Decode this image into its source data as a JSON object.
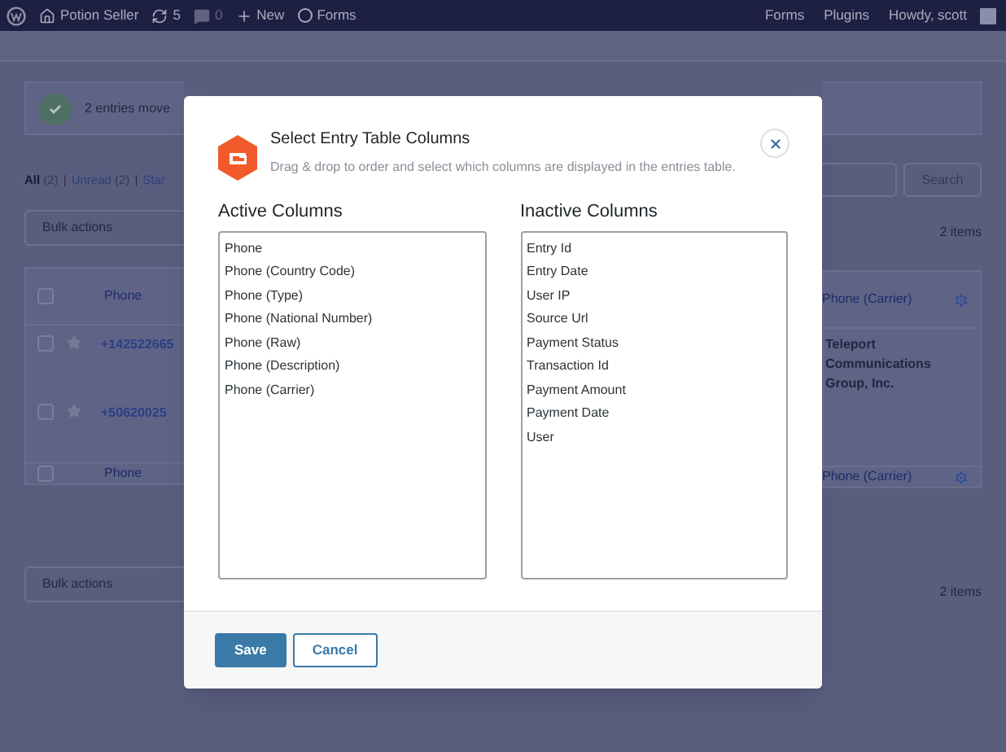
{
  "admin_bar": {
    "site": "Potion Seller",
    "updates": "5",
    "comments": "0",
    "new_label": "New",
    "forms_label": "Forms",
    "right_links": [
      "Forms",
      "Plugins"
    ],
    "greeting": "Howdy, scott"
  },
  "background": {
    "notice": "2 entries move",
    "filters": [
      {
        "label": "All",
        "count": "(2)",
        "selected": true
      },
      {
        "separator": "|",
        "label": "Unread",
        "count": "(2)",
        "selected": false
      },
      {
        "separator": "|",
        "label": "Star",
        "selected": false
      }
    ],
    "bulk_actions_top": "Bulk actions",
    "bulk_actions_bottom": "Bulk actions",
    "search_button": "Search",
    "count_top": "2 items",
    "count_bottom": "2 items",
    "table": {
      "header": [
        "Phone",
        "Phone (Carrier)"
      ],
      "header_checked": false,
      "footer_checked": false,
      "rows": [
        {
          "phone": "+142522665",
          "carrier": "Teleport Communications Group, Inc.",
          "checked": false
        },
        {
          "phone": "+50620025",
          "checked": false
        }
      ],
      "footer": [
        "Phone",
        "Phone (Carrier)"
      ]
    }
  },
  "modal": {
    "title": "Select Entry Table Columns",
    "description": "Drag & drop to order and select which columns are displayed in the entries table.",
    "active_heading": "Active Columns",
    "inactive_heading": "Inactive Columns",
    "active_columns": [
      "Phone",
      "Phone (Country Code)",
      "Phone (Type)",
      "Phone (National Number)",
      "Phone (Raw)",
      "Phone (Description)",
      "Phone (Carrier)"
    ],
    "inactive_columns": [
      "Entry Id",
      "Entry Date",
      "User IP",
      "Source Url",
      "Payment Status",
      "Transaction Id",
      "Payment Amount",
      "Payment Date",
      "User"
    ],
    "save_button": "Save",
    "cancel_button": "Cancel"
  }
}
